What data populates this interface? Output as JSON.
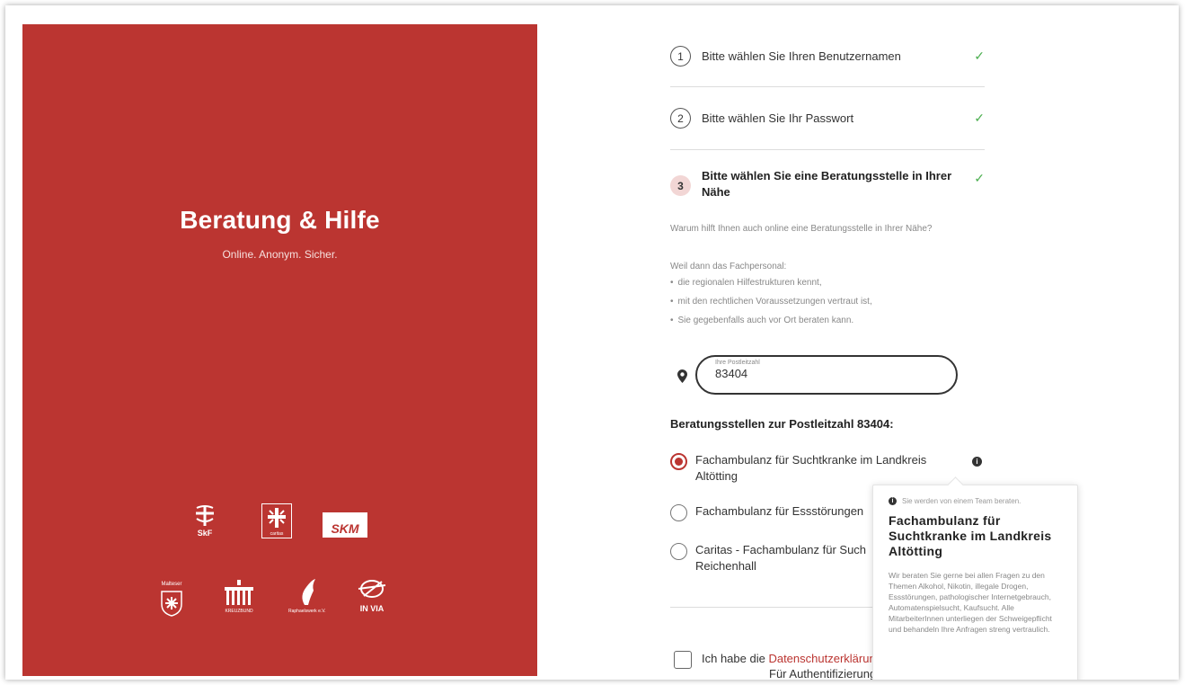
{
  "brand": {
    "title": "Beratung & Hilfe",
    "subtitle": "Online. Anonym. Sicher.",
    "logos": [
      "SkF",
      "caritas",
      "SKM",
      "Malteser",
      "KREUZBUND",
      "Raphaelswerk e.V.",
      "IN VIA"
    ]
  },
  "steps": [
    {
      "number": "1",
      "label": "Bitte wählen Sie Ihren Benutzernamen",
      "done": true
    },
    {
      "number": "2",
      "label": "Bitte wählen Sie Ihr Passwort",
      "done": true
    },
    {
      "number": "3",
      "label": "Bitte wählen Sie eine Beratungsstelle in Ihrer Nähe",
      "done": true
    }
  ],
  "check_symbol": "✓",
  "info": {
    "question": "Warum hilft Ihnen auch online eine Beratungsstelle in Ihrer Nähe?",
    "intro": "Weil dann das Fachpersonal:",
    "bullets": [
      "die regionalen Hilfestrukturen kennt,",
      "mit den rechtlichen Voraussetzungen vertraut ist,",
      "Sie gegebenfalls auch vor Ort beraten kann."
    ]
  },
  "zip": {
    "label": "Ihre Postleitzahl",
    "value": "83404"
  },
  "results": {
    "heading": "Beratungsstellen zur Postleitzahl 83404:",
    "options": [
      {
        "line1": "Fachambulanz für Suchtkranke im Landkreis",
        "line2": "Altötting",
        "selected": true
      },
      {
        "line1": "Fachambulanz für Essstörungen",
        "line2": "",
        "selected": false
      },
      {
        "line1": "Caritas - Fachambulanz für Such",
        "line2": "Reichenhall",
        "selected": false
      }
    ]
  },
  "tooltip": {
    "icon": "i",
    "header": "Sie werden von einem Team beraten.",
    "title": "Fachambulanz für Suchtkranke im Landkreis Altötting",
    "body": "Wir beraten Sie gerne bei allen Fragen zu den Themen Alkohol, Nikotin, illegale Drogen, Essstörungen, pathologischer Internetgebrauch, Automatenspielsucht, Kaufsucht. Alle MitarbeiterInnen unterliegen der Schweigepflicht und behandeln Ihre Anfragen streng vertraulich."
  },
  "consent": {
    "prefix": "Ich habe die ",
    "link": "Datenschutzerklärung",
    "second_line": "Für Authentifizierung"
  },
  "colors": {
    "brand_red": "#bb3531",
    "check_green": "#4caf50"
  },
  "icons": {
    "location": "map-pin-icon",
    "info": "info-icon",
    "check": "check-icon"
  }
}
